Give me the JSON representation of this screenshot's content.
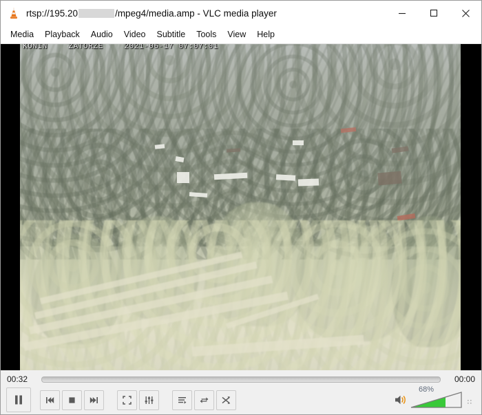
{
  "window": {
    "app_icon": "vlc-cone-icon",
    "title_prefix": "rtsp://195.20",
    "title_suffix": "/mpeg4/media.amp - VLC media player",
    "minimize_label": "minimize-icon",
    "maximize_label": "maximize-icon",
    "close_label": "close-icon"
  },
  "menubar": {
    "items": [
      {
        "label": "Media"
      },
      {
        "label": "Playback"
      },
      {
        "label": "Audio"
      },
      {
        "label": "Video"
      },
      {
        "label": "Subtitle"
      },
      {
        "label": "Tools"
      },
      {
        "label": "View"
      },
      {
        "label": "Help"
      }
    ]
  },
  "video": {
    "osd_location": "KONIN",
    "osd_site": "ZATORZE",
    "osd_timestamp": "2021-06-17 07:07:01"
  },
  "controls": {
    "elapsed_time": "00:32",
    "total_time": "00:00",
    "seek_position_percent": 0,
    "buttons": {
      "play_pause": "pause-button",
      "previous": "previous-button",
      "stop": "stop-button",
      "next": "next-button",
      "fullscreen": "fullscreen-button",
      "extended_settings": "extended-settings-button",
      "playlist": "playlist-button",
      "loop": "loop-button",
      "shuffle": "shuffle-button"
    },
    "volume": {
      "level_label": "68%",
      "level_percent": 68,
      "muted": false
    }
  },
  "colors": {
    "window_bg": "#f0f0f0",
    "titlebar_bg": "#ffffff",
    "text": "#101010",
    "volume_fill": "#39c939",
    "volume_label": "#5f6a7a",
    "video_letterbox": "#000000"
  }
}
